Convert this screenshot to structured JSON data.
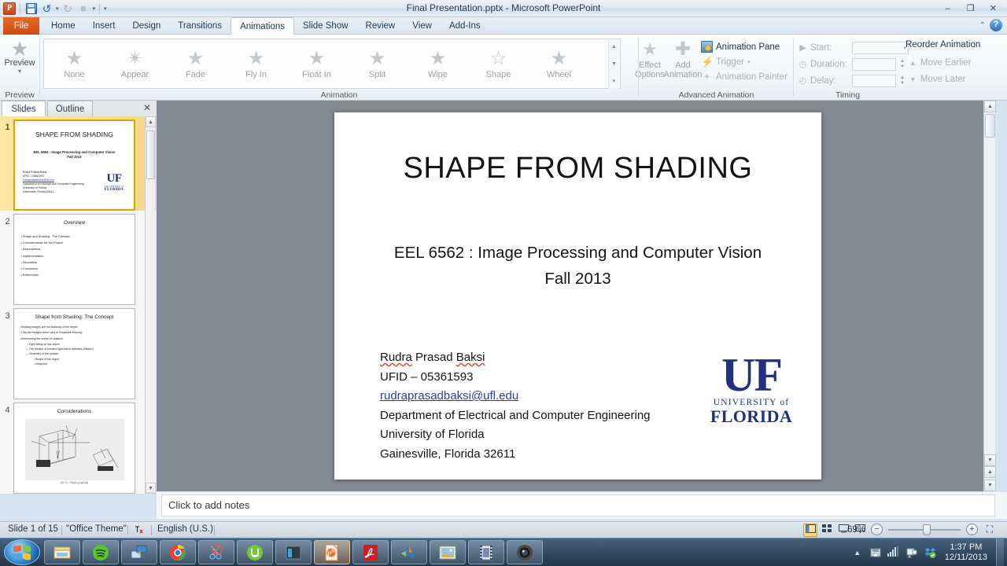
{
  "window": {
    "title": "Final Presentation.pptx  -  Microsoft PowerPoint",
    "app_icon": "powerpoint-orb-icon",
    "minimize": "–",
    "restore": "❐",
    "close": "✕",
    "ribbon_collapse": "⌃",
    "help": "?"
  },
  "quick_access": {
    "save": "save-icon",
    "undo": "undo-icon",
    "undo_caret": "▾",
    "redo": "redo-icon",
    "list": "≡",
    "list_caret": "▾",
    "customize_caret": "▾"
  },
  "tabs": {
    "file": "File",
    "items": [
      {
        "label": "Home",
        "active": false
      },
      {
        "label": "Insert",
        "active": false
      },
      {
        "label": "Design",
        "active": false
      },
      {
        "label": "Transitions",
        "active": false
      },
      {
        "label": "Animations",
        "active": true
      },
      {
        "label": "Slide Show",
        "active": false
      },
      {
        "label": "Review",
        "active": false
      },
      {
        "label": "View",
        "active": false
      },
      {
        "label": "Add-Ins",
        "active": false
      }
    ]
  },
  "ribbon": {
    "preview": {
      "button_label": "Preview",
      "group_label": "Preview",
      "caret": "▾"
    },
    "animation": {
      "group_label": "Animation",
      "gallery": [
        {
          "label": "None"
        },
        {
          "label": "Appear"
        },
        {
          "label": "Fade"
        },
        {
          "label": "Fly In"
        },
        {
          "label": "Float In"
        },
        {
          "label": "Split"
        },
        {
          "label": "Wipe"
        },
        {
          "label": "Shape"
        },
        {
          "label": "Wheel"
        }
      ],
      "scroll_up": "▲",
      "scroll_down": "▼",
      "scroll_more": "▾",
      "effect_options_line1": "Effect",
      "effect_options_line2": "Options",
      "effect_options_caret": "▾",
      "dialog_launcher": "◢"
    },
    "advanced_animation": {
      "group_label": "Advanced Animation",
      "add_animation_line1": "Add",
      "add_animation_line2": "Animation",
      "add_animation_caret": "▾",
      "animation_pane": "Animation Pane",
      "trigger": "Trigger",
      "trigger_caret": "▾",
      "animation_painter": "Animation Painter"
    },
    "timing": {
      "group_label": "Timing",
      "start_label": "Start:",
      "start_value": "",
      "start_caret": "▾",
      "duration_label": "Duration:",
      "duration_value": "",
      "delay_label": "Delay:",
      "delay_value": "",
      "spin_up": "▲",
      "spin_down": "▼",
      "reorder_title": "Reorder Animation",
      "move_earlier": "Move Earlier",
      "move_later": "Move Later",
      "move_earlier_icon": "▲",
      "move_later_icon": "▼"
    }
  },
  "left_panel": {
    "tab_slides": "Slides",
    "tab_outline": "Outline",
    "close": "✕",
    "scroll_up": "▲",
    "scroll_down": "▼",
    "slides": [
      {
        "number": "1",
        "selected": true,
        "title": "SHAPE FROM SHADING",
        "subtitle_line1": "EEL 6562 : Image Processing and Computer Vision",
        "subtitle_line2": "Fall 2013",
        "body": [
          "Rudra Prasad Baksi",
          "UFID – 05361593",
          "rudraprasadbaksi@ufl.edu",
          "Department  of Electrical and Computer  Engineering",
          "University of Florida",
          "Gainesville, Florida 32611"
        ],
        "logo_big": "UF",
        "logo_small1": "UNIVERSITY of",
        "logo_small2": "FLORIDA"
      },
      {
        "number": "2",
        "selected": false,
        "title": "Overview",
        "bullets": [
          "Shape and Shading : The Concept",
          "Considerations for the Project",
          "Assumptions",
          "Implementation",
          "Simulation",
          "Conclusion",
          "References"
        ]
      },
      {
        "number": "3",
        "selected": false,
        "title": "Shape from Shading: The Concept",
        "bullets": [
          {
            "level": 1,
            "text": "Shading images are not shadows of the object"
          },
          {
            "level": 1,
            "text": "They are images which vary in Greyscale intensity"
          },
          {
            "level": 1,
            "text": "Determining the scene of radiance"
          },
          {
            "level": 2,
            "text": "Light falling on the object"
          },
          {
            "level": 2,
            "text": "The fraction of incident  light that is reflected (Albedo)"
          },
          {
            "level": 2,
            "text": "Geometry of the surface"
          },
          {
            "level": 3,
            "text": "Shape of the object"
          },
          {
            "level": 3,
            "text": "Viewpoint"
          }
        ]
      },
      {
        "number": "4",
        "selected": false,
        "title": "Considerations",
        "image_label": "shape-from-shading-geometry-diagram",
        "caption": "I(X,Y) = R(p(x,y),q(x,y))"
      }
    ]
  },
  "slide": {
    "title": "SHAPE FROM SHADING",
    "subtitle_line1": "EEL 6562 : Image Processing and Computer Vision",
    "subtitle_line2": "Fall 2013",
    "author_name_1": "Rudra",
    "author_name_2": " Prasad ",
    "author_name_3": "Baksi",
    "ufid": "UFID – 05361593",
    "email": "rudraprasadbaksi@ufl.edu",
    "department": "Department  of Electrical and Computer  Engineering",
    "university": "University of Florida",
    "city": "Gainesville,  Florida 32611",
    "logo_big": "UF",
    "logo_small1": "UNIVERSITY of",
    "logo_small2": "FLORIDA",
    "logo_color": "#21317E"
  },
  "notes": {
    "placeholder": "Click to add notes"
  },
  "status_bar": {
    "slide_counter": "Slide 1 of 15",
    "theme": "\"Office Theme\"",
    "spell_icon": "spell-check-icon",
    "language": "English (U.S.)",
    "view_normal": "normal-view-icon",
    "view_sorter": "slide-sorter-icon",
    "view_reading": "reading-view-icon",
    "view_slideshow": "slide-show-icon",
    "zoom_level": "69%",
    "zoom_out": "−",
    "zoom_in": "+",
    "fit_to_window": "fit-slide-icon"
  },
  "taskbar": {
    "start": "windows-start-orb-icon",
    "items": [
      {
        "name": "windows-explorer-icon",
        "active": false
      },
      {
        "name": "spotify-icon",
        "active": false
      },
      {
        "name": "remote-desktop-icon",
        "active": false
      },
      {
        "name": "google-chrome-icon",
        "active": false
      },
      {
        "name": "snipping-tool-icon",
        "active": false
      },
      {
        "name": "utorrent-icon",
        "active": false
      },
      {
        "name": "window-app-icon",
        "active": false
      },
      {
        "name": "powerpoint-icon",
        "active": true
      },
      {
        "name": "adobe-reader-icon",
        "active": false
      },
      {
        "name": "matlab-icon",
        "active": false
      },
      {
        "name": "photo-viewer-icon",
        "active": false
      },
      {
        "name": "video-player-icon",
        "active": false
      },
      {
        "name": "camera-icon",
        "active": false
      }
    ],
    "tray": {
      "expand": "▲",
      "removable_media": "safely-remove-hardware-icon",
      "network": "network-signal-icon",
      "action_center": "action-center-icon",
      "dropbox": "dropbox-sync-icon",
      "time": "1:37 PM",
      "date": "12/11/2013"
    }
  }
}
